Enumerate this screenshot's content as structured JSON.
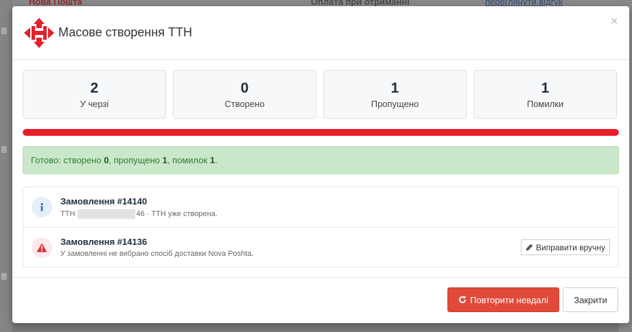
{
  "background": {
    "snippet_left": "Нова Пошта",
    "snippet_center": "Оплата при отриманні",
    "snippet_right": "переглянути відгук"
  },
  "modal": {
    "title": "Масове створення ТТН",
    "close_glyph": "×"
  },
  "stats": [
    {
      "value": "2",
      "label": "У черзі"
    },
    {
      "value": "0",
      "label": "Створено"
    },
    {
      "value": "1",
      "label": "Пропущено"
    },
    {
      "value": "1",
      "label": "Помилки"
    }
  ],
  "progress": {
    "fraction": 1.0,
    "color": "#e5202a"
  },
  "summary": {
    "prefix": "Готово: створено ",
    "created": "0",
    "mid1": ", пропущено ",
    "skipped": "1",
    "mid2": ", помилок ",
    "errors": "1",
    "suffix": "."
  },
  "items": [
    {
      "icon": "info-icon",
      "title": "Замовлення #14140",
      "sub_prefix": "ТТН ",
      "sub_tail": "46 · ТТН уже створена."
    },
    {
      "icon": "warning-icon",
      "title": "Замовлення #14136",
      "sub": "У замовленні не вибрано спосіб доставки Nova Poshta.",
      "action_label": "Виправити вручну"
    }
  ],
  "footer": {
    "retry_label": "Повторити невдалі",
    "close_label": "Закрити"
  },
  "colors": {
    "brand_red": "#e5202a",
    "retry_button": "#e04a3a",
    "success_bg": "#c9e7c9",
    "success_text": "#2e7d32"
  }
}
